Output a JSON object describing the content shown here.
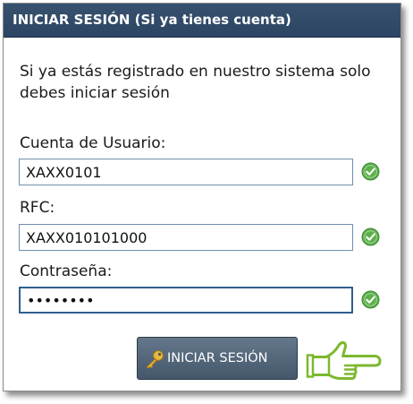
{
  "panel": {
    "title": "INICIAR SESIÓN (Si ya tienes cuenta)",
    "intro": "Si ya estás registrado en nuestro sistema solo debes iniciar sesión"
  },
  "form": {
    "username": {
      "label": "Cuenta de Usuario:",
      "value": "XAXX0101",
      "status_icon": "check-circle-icon"
    },
    "rfc": {
      "label": "RFC:",
      "value": "XAXX010101000",
      "status_icon": "check-circle-icon"
    },
    "password": {
      "label": "Contraseña:",
      "value": "••••••••",
      "status_icon": "check-circle-icon"
    },
    "submit_label": "INICIAR SESIÓN",
    "submit_icon": "key-icon",
    "pointer_icon": "pointing-hand-icon"
  },
  "colors": {
    "header": "#2c4562",
    "button": "#52657a",
    "check": "#5cb04a",
    "pointer": "#8dc63f"
  }
}
